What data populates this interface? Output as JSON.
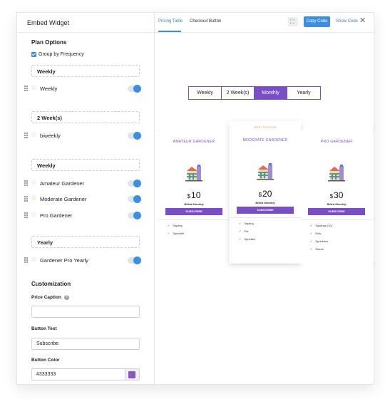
{
  "left": {
    "title": "Embed Widget",
    "plan_options_title": "Plan Options",
    "group_by_frequency": "Group by Frequency",
    "groups": [
      {
        "label": "Weekly",
        "plans": [
          {
            "label": "Weekly",
            "starred": false
          }
        ]
      },
      {
        "label": "2 Week(s)",
        "plans": [
          {
            "label": "biweekly",
            "starred": false
          }
        ]
      },
      {
        "label": "Weekly",
        "plans": [
          {
            "label": "Amateur Gardener",
            "starred": false
          },
          {
            "label": "Moderate Gardener",
            "starred": true
          },
          {
            "label": "Pro Gardener",
            "starred": false
          }
        ]
      },
      {
        "label": "Yearly",
        "plans": [
          {
            "label": "Gardener Pro Yearly",
            "starred": false
          }
        ]
      }
    ],
    "customization_title": "Customization",
    "price_caption_label": "Price Caption",
    "price_caption_value": "",
    "button_text_label": "Button Text",
    "button_text_value": "Subscribe",
    "button_color_label": "Button Color",
    "button_color_value": "#333333",
    "button_color_swatch": "#8a55c7"
  },
  "right": {
    "tabs": [
      {
        "label": "Pricing Table",
        "active": true
      },
      {
        "label": "Checkout Button",
        "active": false
      }
    ],
    "copy_code": "Copy Code",
    "show_code": "Show Code",
    "frequency": [
      {
        "label": "Weekly",
        "active": false
      },
      {
        "label": "2 Week(s)",
        "active": false
      },
      {
        "label": "Monthly",
        "active": true
      },
      {
        "label": "Yearly",
        "active": false
      }
    ],
    "cards": [
      {
        "badge": "",
        "name": "AMATEUR GARDENER",
        "currency": "$",
        "amount": "10",
        "billed": "Billed Monthly",
        "button": "SUBSCRIBE",
        "features": [
          "Sapling",
          "Sprinkler"
        ]
      },
      {
        "badge": "MOST POPULAR",
        "name": "MODERATE GARDENER",
        "currency": "$",
        "amount": "20",
        "billed": "Billed Monthly",
        "button": "SUBSCRIBE",
        "features": [
          "Sapling",
          "Pot",
          "Sprinkler"
        ]
      },
      {
        "badge": "",
        "name": "PRO GARDENER",
        "currency": "$",
        "amount": "30",
        "billed": "Billed Monthly",
        "button": "SUBSCRIBE",
        "features": [
          "Saplings (10)",
          "Pots",
          "Sprinklers",
          "Seeds"
        ]
      }
    ],
    "accent_color": "#7a4ec6",
    "primary_color": "#3a8ee6"
  }
}
